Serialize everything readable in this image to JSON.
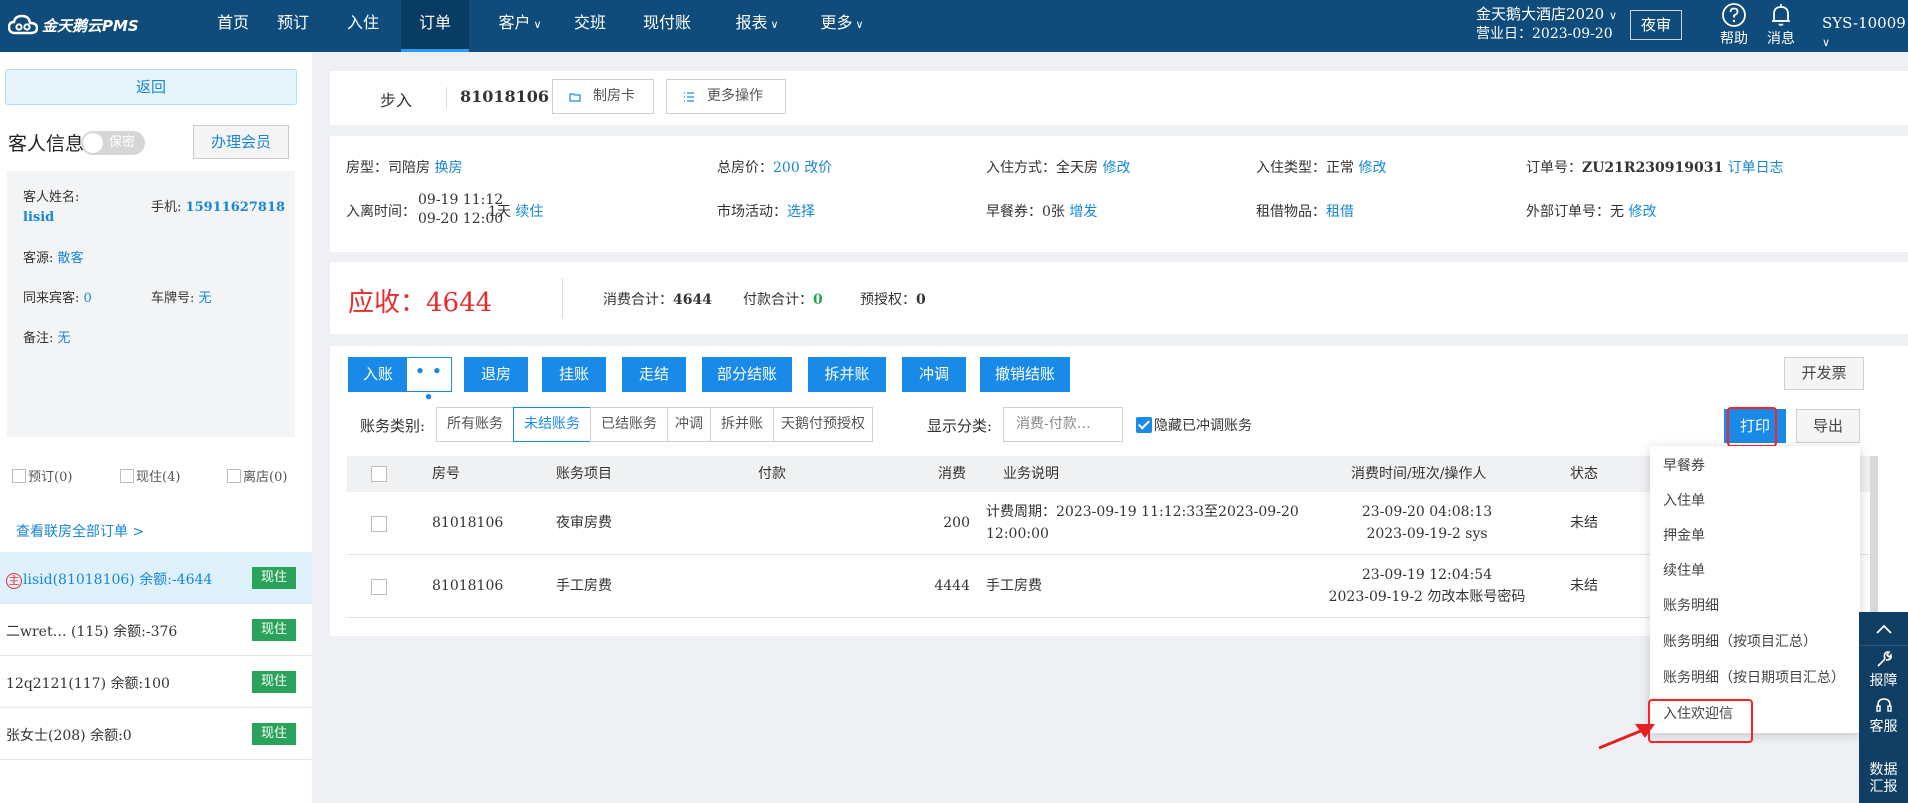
{
  "nav": {
    "logo": "金天鹅云PMS",
    "items": [
      {
        "label": "首页",
        "chev": ""
      },
      {
        "label": "预订",
        "chev": ""
      },
      {
        "label": "入住",
        "chev": ""
      },
      {
        "label": "订单",
        "chev": ""
      },
      {
        "label": "客户",
        "chev": "∨"
      },
      {
        "label": "交班",
        "chev": ""
      },
      {
        "label": "现付账",
        "chev": ""
      },
      {
        "label": "报表",
        "chev": "∨"
      },
      {
        "label": "更多",
        "chev": "∨"
      }
    ],
    "hotel": "金天鹅大酒店2020",
    "hotel_chev": "∨",
    "business_date": "营业日：2023-09-20",
    "night_audit": "夜审",
    "help": "帮助",
    "messages": "消息",
    "user": "SYS-10009",
    "user_chev": "∨"
  },
  "left": {
    "back": "返回",
    "guest_info_title": "客人信息",
    "privacy_toggle": "保密",
    "member_button": "办理会员",
    "guest": {
      "name_label": "客人姓名:",
      "name": "lisid",
      "phone_label": "手机:",
      "phone": "15911627818",
      "source_label": "客源:",
      "source": "散客",
      "companions_label": "同来宾客:",
      "companions": "0",
      "plate_label": "车牌号:",
      "plate": "无",
      "remark_label": "备注:",
      "remark": "无"
    },
    "filters": [
      {
        "label": "预订(0)"
      },
      {
        "label": "现住(4)"
      },
      {
        "label": "离店(0)"
      }
    ],
    "view_all": "查看联房全部订单 >",
    "host_mark": "主",
    "rooms": [
      {
        "label": "lisid(81018106)   余额:-4644",
        "status": "现住"
      },
      {
        "label": "二wret… (115)   余额:-376",
        "status": "现住"
      },
      {
        "label": "12q2121(117)   余额:100",
        "status": "现住"
      },
      {
        "label": "张女士(208)   余额:0",
        "status": "现住"
      }
    ]
  },
  "header": {
    "checkin_mode": "步入",
    "order_no": "81018106",
    "make_card": "制房卡",
    "more_ops": "更多操作"
  },
  "info": {
    "room_type_label": "房型：",
    "room_type": "司陪房",
    "change_room": "换房",
    "total_price_label": "总房价：",
    "total_price": "200",
    "change_price": "改价",
    "checkin_method_label": "入住方式：",
    "checkin_method": "全天房",
    "modify": "修改",
    "checkin_type_label": "入住类型：",
    "checkin_type": "正常",
    "order_no_label": "订单号：",
    "order_no_full": "ZU21R230919031",
    "order_log": "订单日志",
    "stay_label": "入离时间：",
    "stay_in": "09-19 11:12",
    "stay_out": "09-20 12:00",
    "nights": "1天",
    "extend": "续住",
    "market_label": "市场活动：",
    "market_select": "选择",
    "breakfast_label": "早餐券：",
    "breakfast": "0张",
    "breakfast_add": "增发",
    "rental_label": "租借物品：",
    "rental": "租借",
    "ext_order_label": "外部订单号：",
    "ext_order": "无",
    "ext_modify": "修改"
  },
  "amounts": {
    "receivable_label": "应收：",
    "receivable": "4644",
    "consume_label": "消费合计：",
    "consume": "4644",
    "payment_label": "付款合计：",
    "payment": "0",
    "preauth_label": "预授权：",
    "preauth": "0"
  },
  "actions": {
    "post": "入账",
    "post_more": "• • •",
    "refund_room": "退房",
    "hang": "挂账",
    "walk_settle": "走结",
    "partial_settle": "部分结账",
    "split_merge": "拆并账",
    "adjust": "冲调",
    "cancel_settle": "撤销结账",
    "invoice": "开发票",
    "print": "打印",
    "export": "导出"
  },
  "filter": {
    "label": "账务类别:",
    "tabs": [
      "所有账务",
      "未结账务",
      "已结账务",
      "冲调",
      "拆并账",
      "天鹅付预授权"
    ],
    "show_label": "显示分类:",
    "show_value": "消费-付款…",
    "hide_adjusted": "隐藏已冲调账务"
  },
  "table": {
    "headers": {
      "room": "房号",
      "item": "账务项目",
      "payment": "付款",
      "consume": "消费",
      "desc": "业务说明",
      "time": "消费时间/班次/操作人",
      "status": "状态"
    },
    "rows": [
      {
        "room": "81018106",
        "item": "夜审房费",
        "payment": "",
        "consume": "200",
        "desc1": "计费周期：2023-09-19 11:12:33至2023-09-20",
        "desc2": "12:00:00",
        "time1": "23-09-20 04:08:13",
        "time2": "2023-09-19-2 sys",
        "status": "未结"
      },
      {
        "room": "81018106",
        "item": "手工房费",
        "payment": "",
        "consume": "4444",
        "desc1": "手工房费",
        "desc2": "",
        "time1": "23-09-19 12:04:54",
        "time2": "2023-09-19-2 勿改本账号密码",
        "status": "未结"
      }
    ]
  },
  "print_menu": [
    "早餐券",
    "入住单",
    "押金单",
    "续住单",
    "账务明细",
    "账务明细（按项目汇总）",
    "账务明细（按日期项目汇总）",
    "入住欢迎信"
  ],
  "float_bar": {
    "repair": "报障",
    "service": "客服",
    "data_report_1": "数据",
    "data_report_2": "汇报"
  }
}
